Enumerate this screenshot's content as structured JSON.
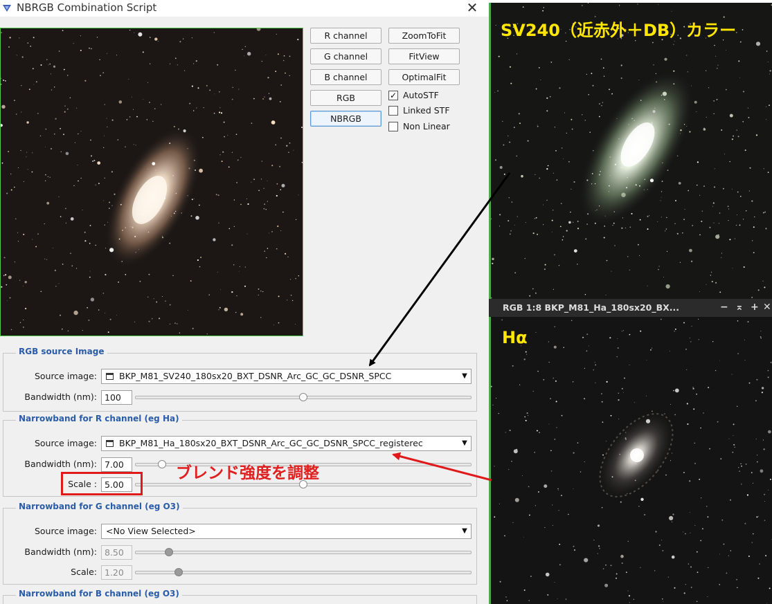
{
  "window": {
    "title": "NBRGB Combination Script",
    "close_glyph": "✕"
  },
  "buttons": {
    "r_channel": "R channel",
    "g_channel": "G channel",
    "b_channel": "B channel",
    "rgb": "RGB",
    "nbrgb": "NBRGB",
    "zoom_to_fit": "ZoomToFit",
    "fit_view": "FitView",
    "optimal_fit": "OptimalFit"
  },
  "checkboxes": {
    "auto_stf": {
      "label": "AutoSTF",
      "checked": true,
      "mark": "✓"
    },
    "linked_stf": {
      "label": "Linked STF",
      "checked": false,
      "mark": ""
    },
    "non_linear": {
      "label": "Non Linear",
      "checked": false,
      "mark": ""
    }
  },
  "rgb_source": {
    "title": "RGB source Image",
    "source_label": "Source image:",
    "source_value": "BKP_M81_SV240_180sx20_BXT_DSNR_Arc_GC_GC_DSNR_SPCC",
    "bandwidth_label": "Bandwidth (nm):",
    "bandwidth_value": "100",
    "bandwidth_level": 0.5
  },
  "nb_r": {
    "title": "Narrowband for R channel (eg Ha)",
    "source_label": "Source image:",
    "source_value": "BKP_M81_Ha_180sx20_BXT_DSNR_Arc_GC_GC_DSNR_SPCC_registerec",
    "bandwidth_label": "Bandwidth (nm):",
    "bandwidth_value": "7.00",
    "bandwidth_level": 0.08,
    "scale_label": "Scale :",
    "scale_value": "5.00",
    "scale_level": 0.5
  },
  "nb_g": {
    "title": "Narrowband for G channel (eg O3)",
    "source_label": "Source image:",
    "source_value": "<No View Selected>",
    "bandwidth_label": "Bandwidth (nm):",
    "bandwidth_value": "8.50",
    "bandwidth_level": 0.1,
    "scale_label": "Scale:",
    "scale_value": "1.20",
    "scale_level": 0.13
  },
  "nb_b": {
    "title": "Narrowband for B channel (eg O3)"
  },
  "combo_arrow": "▼",
  "annotation": {
    "text": "ブレンド強度を調整",
    "color": "#e02020"
  },
  "right_panes": {
    "top_caption": "SV240（近赤外＋DB）カラー",
    "bottom_caption": "Hα",
    "separator_title": "RGB 1:8 BKP_M81_Ha_180sx20_BX...",
    "sep_minimize": "−",
    "sep_shade": "⌅",
    "sep_add": "+",
    "sep_close": "✕"
  },
  "colors": {
    "accent_blue": "#2a5ca7",
    "highlight_red": "#e01a1a",
    "caption_yellow": "#ffe600",
    "view_border_green": "#4fa84f"
  }
}
